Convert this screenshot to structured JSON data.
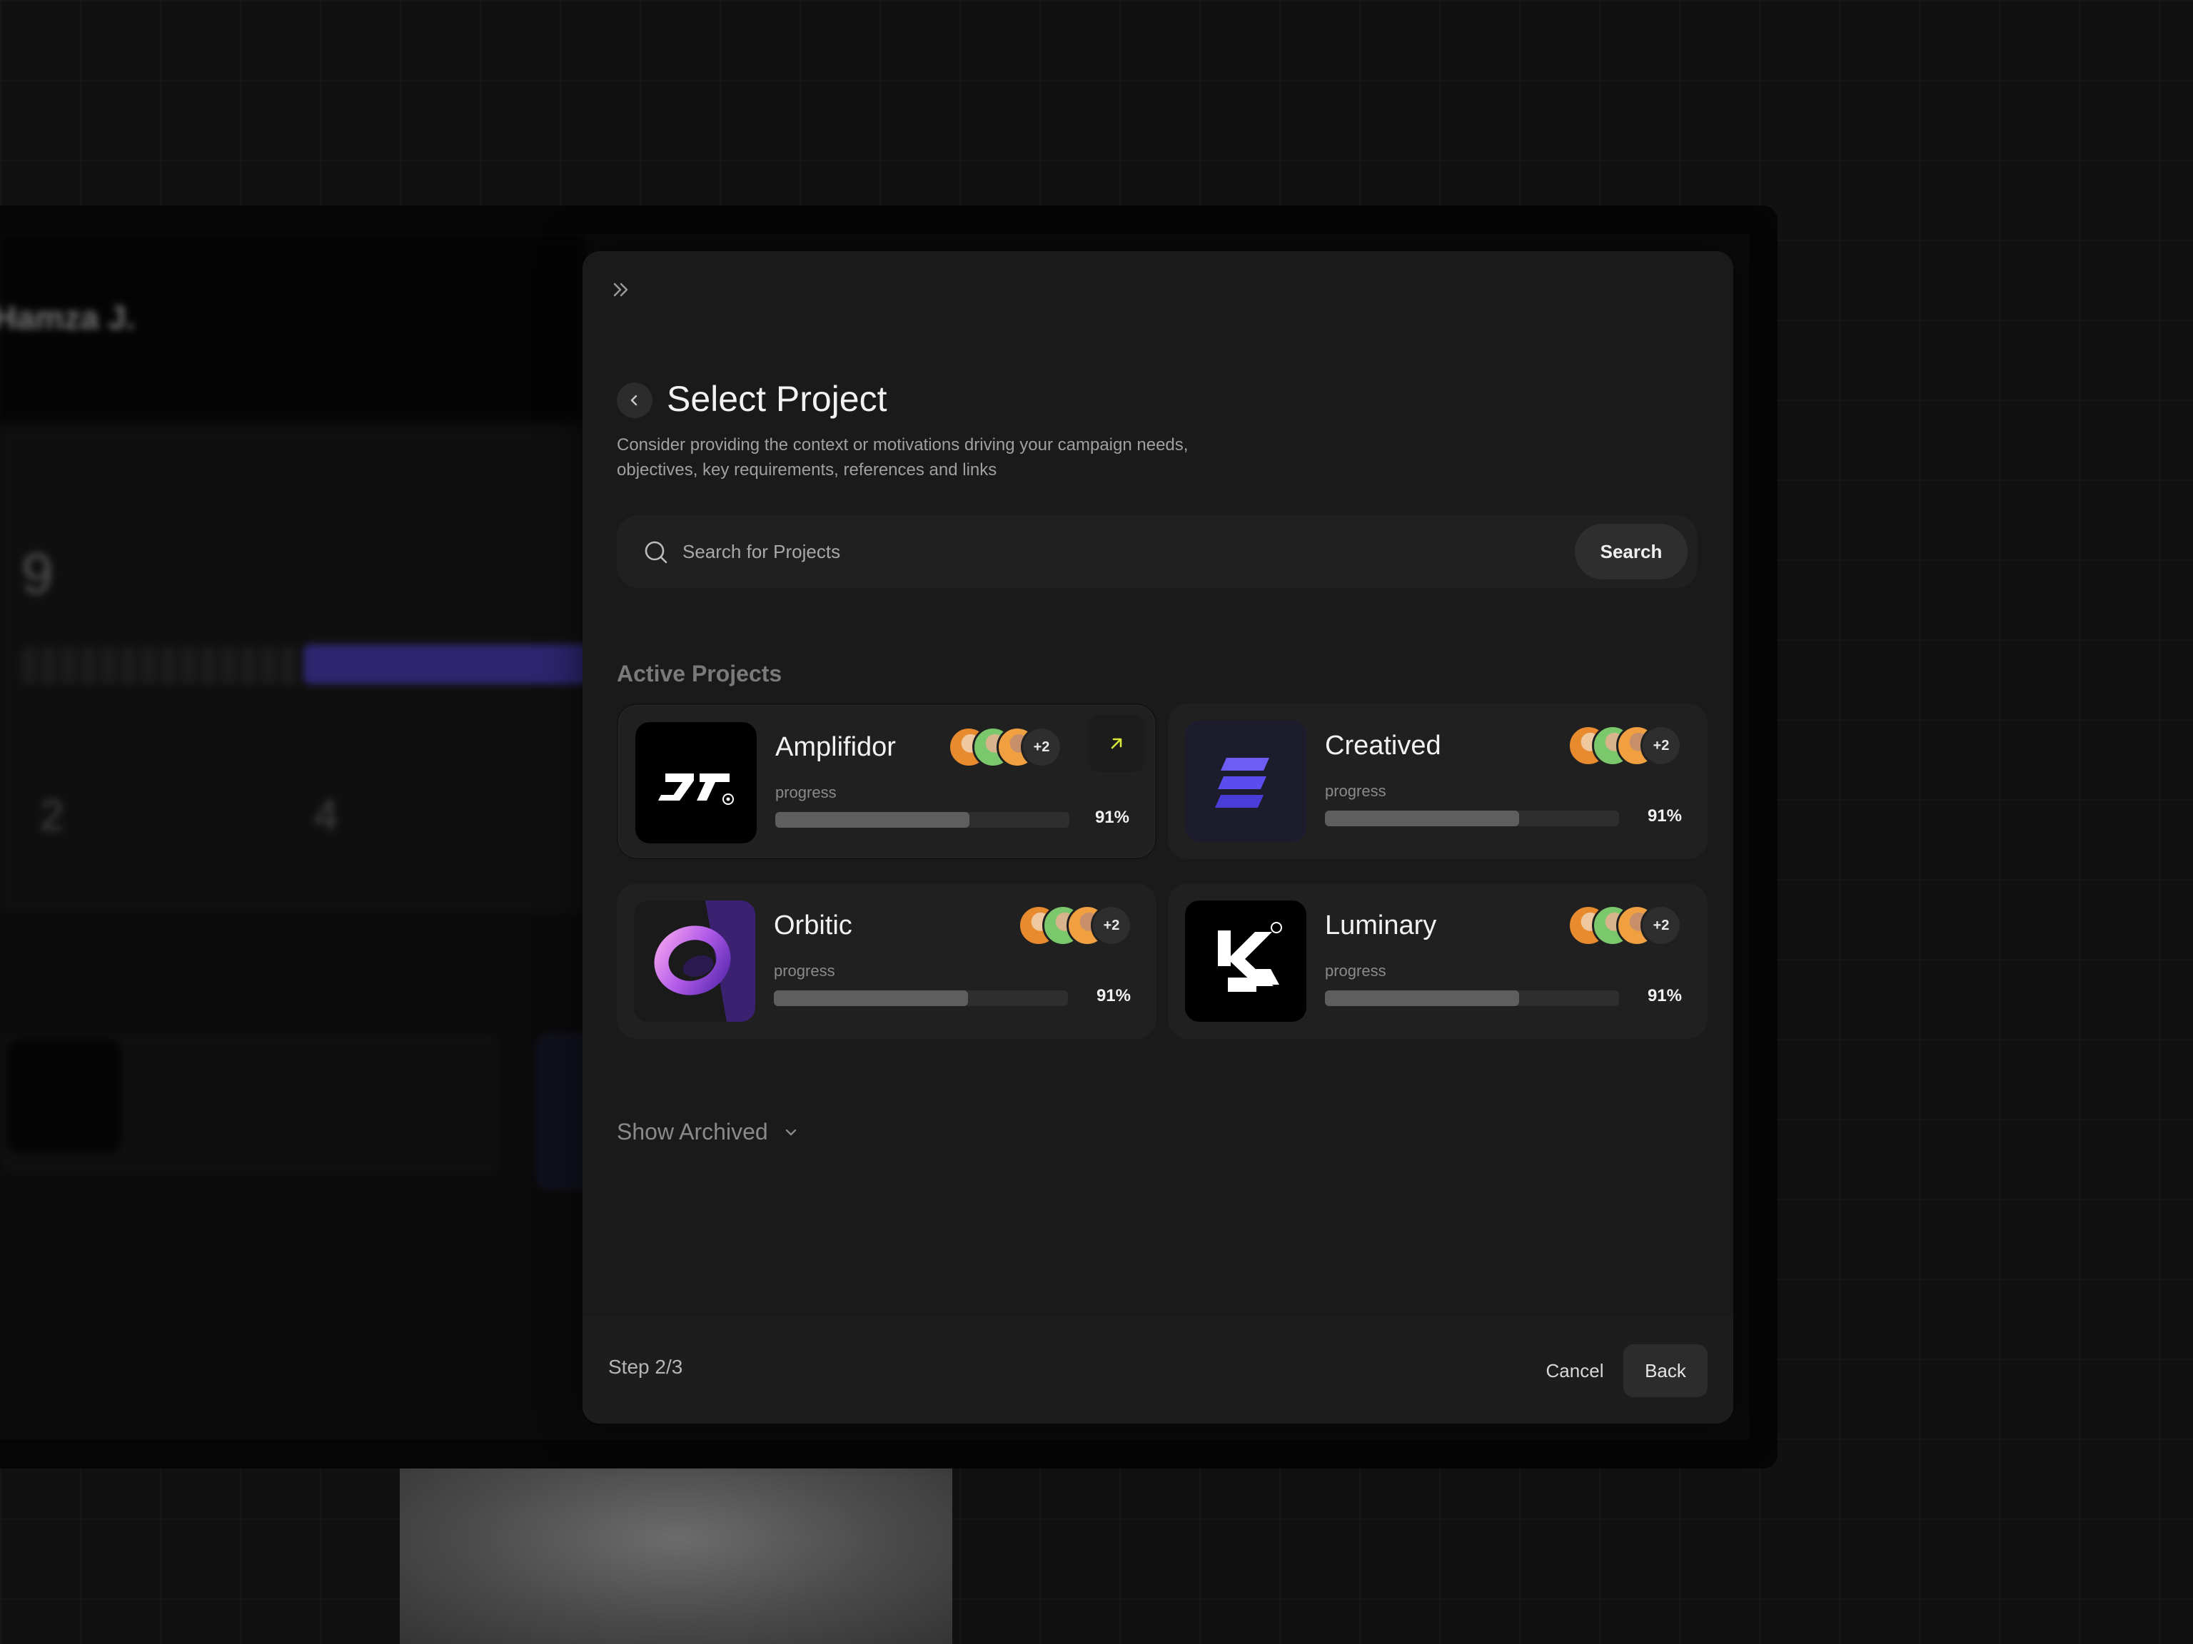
{
  "background": {
    "user_name": "Hamza J.",
    "big_number": "9",
    "stat_a": "2",
    "stat_b": "4"
  },
  "modal": {
    "title": "Select Project",
    "description": "Consider providing the context or motivations driving your campaign needs, objectives, key requirements, references and links",
    "search": {
      "placeholder": "Search for Projects",
      "button_label": "Search"
    },
    "section_title": "Active Projects",
    "projects": [
      {
        "name": "Amplifidor",
        "progress_label": "progress",
        "progress": 0.66,
        "progress_text": "91%",
        "extra_members": "+2",
        "selected": true
      },
      {
        "name": "Creatived",
        "progress_label": "progress",
        "progress": 0.66,
        "progress_text": "91%",
        "extra_members": "+2",
        "selected": false
      },
      {
        "name": "Orbitic",
        "progress_label": "progress",
        "progress": 0.66,
        "progress_text": "91%",
        "extra_members": "+2",
        "selected": false
      },
      {
        "name": "Luminary",
        "progress_label": "progress",
        "progress": 0.66,
        "progress_text": "91%",
        "extra_members": "+2",
        "selected": false
      }
    ],
    "show_archived_label": "Show Archived",
    "footer": {
      "step_label": "Step 2/3",
      "cancel_label": "Cancel",
      "back_label": "Back"
    }
  },
  "colors": {
    "accent_arrow": "#d9e63a",
    "creatived_logo": "#5b4cf0",
    "orbitic_logo": "#c46ae6"
  }
}
